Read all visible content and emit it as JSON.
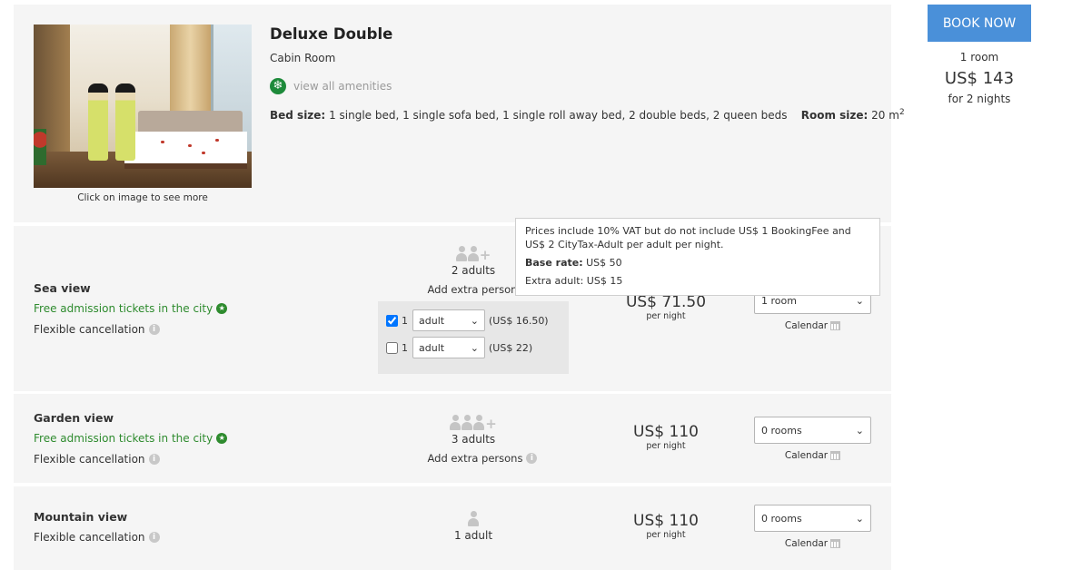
{
  "room": {
    "title": "Deluxe Double",
    "subtitle": "Cabin Room",
    "amenities_link": "view all amenities",
    "image_caption": "Click on image to see more",
    "bed_size_label": "Bed size:",
    "bed_size_value": "1 single bed, 1 single sofa bed, 1 single roll away bed, 2 double beds, 2 queen beds",
    "room_size_label": "Room size:",
    "room_size_value": "20 m",
    "room_size_unit_sup": "2"
  },
  "booking": {
    "button_label": "BOOK NOW",
    "rooms": "1 room",
    "total_price": "US$ 143",
    "nights": "for 2 nights"
  },
  "rates": [
    {
      "name": "Sea view",
      "perk": "Free admission tickets in the city",
      "cancellation": "Flexible cancellation",
      "adults": "2 adults",
      "extra_persons": "Add extra persons",
      "extras": [
        {
          "checked": true,
          "count": "1",
          "type": "adult",
          "price": "(US$ 16.50)"
        },
        {
          "checked": false,
          "count": "1",
          "type": "adult",
          "price": "(US$ 22)"
        }
      ],
      "price": "US$ 71.50",
      "per_night": "per night",
      "rooms_selected": "1 room",
      "calendar": "Calendar"
    },
    {
      "name": "Garden view",
      "perk": "Free admission tickets in the city",
      "cancellation": "Flexible cancellation",
      "adults": "3 adults",
      "extra_persons": "Add extra persons",
      "price": "US$ 110",
      "per_night": "per night",
      "rooms_selected": "0 rooms",
      "calendar": "Calendar"
    },
    {
      "name": "Mountain view",
      "cancellation": "Flexible cancellation",
      "adults": "1 adult",
      "price": "US$ 110",
      "per_night": "per night",
      "rooms_selected": "0 rooms",
      "calendar": "Calendar"
    }
  ],
  "tooltip": {
    "line1": "Prices include 10% VAT but do not include US$ 1 BookingFee and US$ 2 CityTax-Adult per adult per night.",
    "base_rate_label": "Base rate:",
    "base_rate_value": "US$ 50",
    "extra_adult": "Extra adult: US$ 15"
  },
  "icons": {
    "amenities": "snowflake-icon",
    "perk": "star-icon",
    "info": "info-icon",
    "calendar": "calendar-icon",
    "person": "person-icon",
    "dropdown": "chevron-down-icon"
  },
  "colors": {
    "book_button": "#4a90d9",
    "perk_text": "#2e8b2e",
    "amenity_icon": "#1d8a3a",
    "panel_bg": "#f5f5f5"
  }
}
